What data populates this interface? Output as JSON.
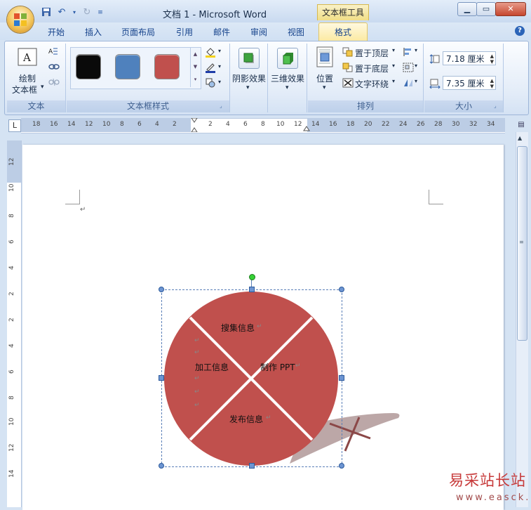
{
  "window": {
    "title": "文档 1 - Microsoft Word",
    "context_tab": "文本框工具",
    "minimize": "▁",
    "maximize": "▭",
    "close": "✕"
  },
  "tabs": [
    "开始",
    "插入",
    "页面布局",
    "引用",
    "邮件",
    "审阅",
    "视图"
  ],
  "active_tab": "格式",
  "ribbon": {
    "text_group": {
      "label": "文本",
      "draw_textbox_line1": "绘制",
      "draw_textbox_line2": "文本框",
      "dropdown": "▾"
    },
    "styles_group": {
      "label": "文本框样式",
      "swatches": [
        "#0a0a0a",
        "#4f81bd",
        "#c0504d"
      ]
    },
    "shadow_group": {
      "label": "阴影效果",
      "dropdown": "▾"
    },
    "threed_group": {
      "label": "三维效果",
      "dropdown": "▾"
    },
    "arrange_group": {
      "label": "排列",
      "position": "位置",
      "position_dropdown": "▾",
      "bring_front": "置于顶层",
      "send_back": "置于底层",
      "text_wrap": "文字环绕",
      "dropdown": "▾"
    },
    "size_group": {
      "label": "大小",
      "height": "7.18 厘米",
      "width": "7.35 厘米"
    }
  },
  "ruler": {
    "tab_selector": "L",
    "h_left_ticks": [
      "18",
      "16",
      "14",
      "12",
      "10",
      "8",
      "6",
      "4",
      "2"
    ],
    "h_right_ticks": [
      "2",
      "4",
      "6",
      "8",
      "10",
      "12",
      "14",
      "16",
      "18",
      "20",
      "22",
      "24",
      "26",
      "28",
      "30",
      "32",
      "34"
    ],
    "v_ticks": [
      "12",
      "10",
      "8",
      "6",
      "4",
      "2",
      "2",
      "4",
      "6",
      "8",
      "10",
      "12",
      "14"
    ]
  },
  "document": {
    "paragraph_mark": "↵",
    "segments": {
      "top": "搜集信息",
      "left": "加工信息",
      "right": "制作 PPT",
      "bottom": "发布信息"
    },
    "segment_color": "#c0504d"
  },
  "watermark": {
    "cn": "易采站长站",
    "en": "www.easck.com"
  }
}
